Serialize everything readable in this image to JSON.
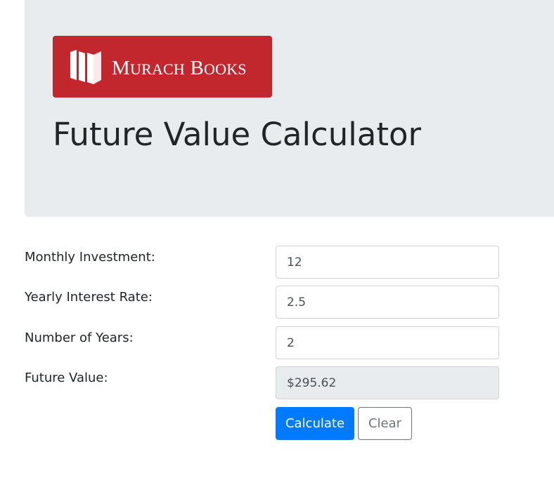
{
  "header": {
    "logo": {
      "brand_text": "Murach Books",
      "background_color": "#c1272d",
      "icon": "book-pages-icon"
    },
    "title": "Future Value Calculator"
  },
  "form": {
    "monthly_investment": {
      "label": "Monthly Investment:",
      "value": "12"
    },
    "interest_rate": {
      "label": "Yearly Interest Rate:",
      "value": "2.5"
    },
    "years": {
      "label": "Number of Years:",
      "value": "2"
    },
    "future_value": {
      "label": "Future Value:",
      "value": "$295.62"
    }
  },
  "buttons": {
    "calculate_label": "Calculate",
    "clear_label": "Clear"
  },
  "colors": {
    "header_bg": "#e9ecef",
    "primary": "#007bff",
    "secondary": "#6c757d"
  }
}
